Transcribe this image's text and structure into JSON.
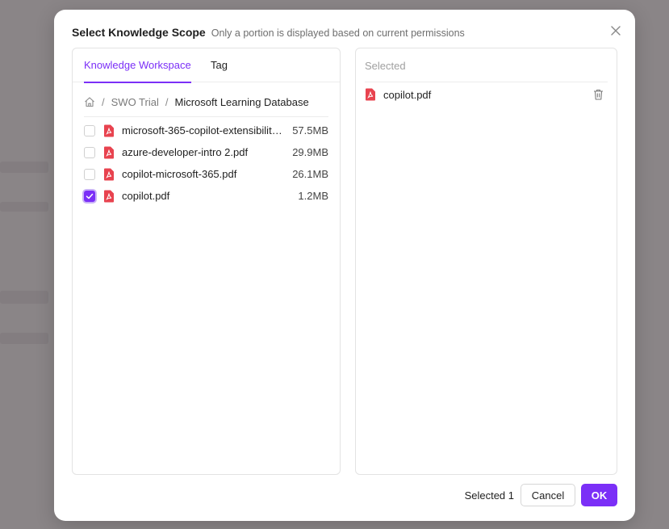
{
  "modal": {
    "title": "Select Knowledge Scope",
    "subtitle": "Only a portion is displayed based on current permissions"
  },
  "tabs": [
    {
      "label": "Knowledge Workspace",
      "active": true
    },
    {
      "label": "Tag",
      "active": false
    }
  ],
  "breadcrumb": {
    "home_icon": "home-icon",
    "items": [
      "SWO Trial",
      "Microsoft Learning Database"
    ]
  },
  "files": [
    {
      "name": "microsoft-365-copilot-extensibility....",
      "size": "57.5MB",
      "checked": false
    },
    {
      "name": "azure-developer-intro 2.pdf",
      "size": "29.9MB",
      "checked": false
    },
    {
      "name": "copilot-microsoft-365.pdf",
      "size": "26.1MB",
      "checked": false
    },
    {
      "name": "copilot.pdf",
      "size": "1.2MB",
      "checked": true
    }
  ],
  "selected_panel": {
    "header": "Selected",
    "items": [
      {
        "name": "copilot.pdf"
      }
    ]
  },
  "footer": {
    "selected_count": "Selected 1",
    "cancel_label": "Cancel",
    "ok_label": "OK"
  },
  "colors": {
    "accent": "#7b2ff7",
    "pdf_icon": "#e8434f",
    "overlay": "#8a8587"
  }
}
